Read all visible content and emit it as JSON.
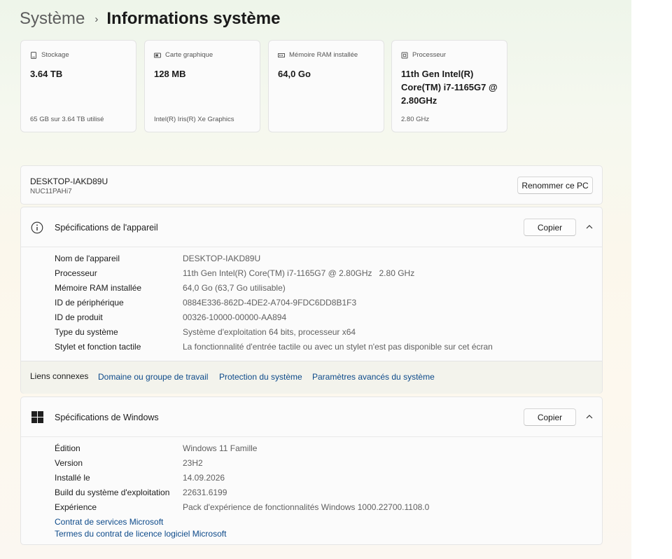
{
  "breadcrumb": {
    "parent": "Système",
    "separator": "›",
    "current": "Informations système"
  },
  "cards": [
    {
      "icon": "storage-icon",
      "label": "Stockage",
      "value": "3.64 TB",
      "sub": "65 GB sur 3.64 TB utilisé"
    },
    {
      "icon": "graphics-card-icon",
      "label": "Carte graphique",
      "value": "128 MB",
      "sub": "Intel(R) Iris(R) Xe Graphics"
    },
    {
      "icon": "ram-icon",
      "label": "Mémoire RAM installée",
      "value": "64,0 Go",
      "sub": ""
    },
    {
      "icon": "processor-icon",
      "label": "Processeur",
      "value": "11th Gen Intel(R) Core(TM) i7-1165G7 @ 2.80GHz",
      "sub": "2.80 GHz"
    }
  ],
  "device": {
    "name": "DESKTOP-IAKD89U",
    "model": "NUC11PAHi7",
    "rename_label": "Renommer ce PC"
  },
  "device_specs": {
    "title": "Spécifications de l'appareil",
    "copy_label": "Copier",
    "rows": [
      {
        "label": "Nom de l'appareil",
        "value": "DESKTOP-IAKD89U"
      },
      {
        "label": "Processeur",
        "value": "11th Gen Intel(R) Core(TM) i7-1165G7 @ 2.80GHz   2.80 GHz"
      },
      {
        "label": "Mémoire RAM installée",
        "value": "64,0 Go (63,7 Go utilisable)"
      },
      {
        "label": "ID de périphérique",
        "value": "0884E336-862D-4DE2-A704-9FDC6DD8B1F3"
      },
      {
        "label": "ID de produit",
        "value": "00326-10000-00000-AA894"
      },
      {
        "label": "Type du système",
        "value": "Système d'exploitation 64 bits, processeur x64"
      },
      {
        "label": "Stylet et fonction tactile",
        "value": "La fonctionnalité d'entrée tactile ou avec un stylet n'est pas disponible sur cet écran"
      }
    ],
    "related_links_label": "Liens connexes",
    "related_links": [
      "Domaine ou groupe de travail",
      "Protection du système",
      "Paramètres avancés du système"
    ]
  },
  "windows_specs": {
    "title": "Spécifications de Windows",
    "copy_label": "Copier",
    "rows": [
      {
        "label": "Édition",
        "value": "Windows 11 Famille"
      },
      {
        "label": "Version",
        "value": "23H2"
      },
      {
        "label": "Installé le",
        "value": "14.09.2026"
      },
      {
        "label": "Build du système d'exploitation",
        "value": "22631.6199"
      },
      {
        "label": "Expérience",
        "value": "Pack d'expérience de fonctionnalités Windows 1000.22700.1108.0"
      }
    ],
    "links": [
      "Contrat de services Microsoft",
      "Termes du contrat de licence logiciel Microsoft"
    ]
  },
  "colors": {
    "link": "#0d4a8a",
    "card_bg": "#fbfbfb",
    "links_bar_bg": "#f3f3ec"
  }
}
